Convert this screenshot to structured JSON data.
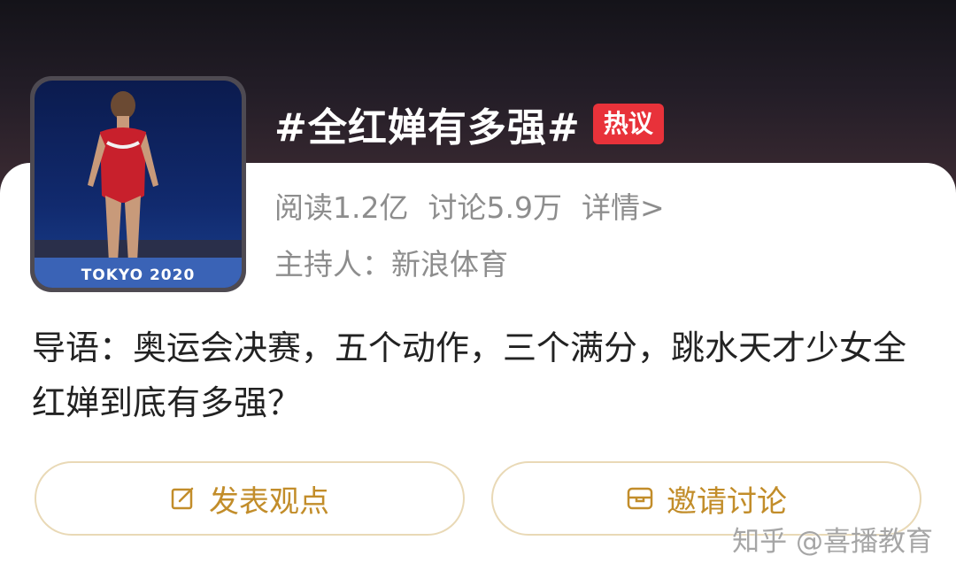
{
  "topic": {
    "title": "#全红婵有多强#",
    "badge": "热议",
    "cover_caption": "TOKYO 2020"
  },
  "stats": {
    "read": "阅读1.2亿",
    "discuss": "讨论5.9万",
    "detail": "详情>"
  },
  "host": "主持人：新浪体育",
  "intro": "导语：奥运会决赛，五个动作，三个满分，跳水天才少女全红婵到底有多强？",
  "actions": {
    "post": "发表观点",
    "invite": "邀请讨论"
  },
  "watermark": "知乎 @喜播教育",
  "colors": {
    "accent": "#c28d2a",
    "badge": "#e8323a",
    "button_border": "#e9d9b6"
  },
  "icons": {
    "post": "edit-icon",
    "invite": "mail-icon"
  }
}
